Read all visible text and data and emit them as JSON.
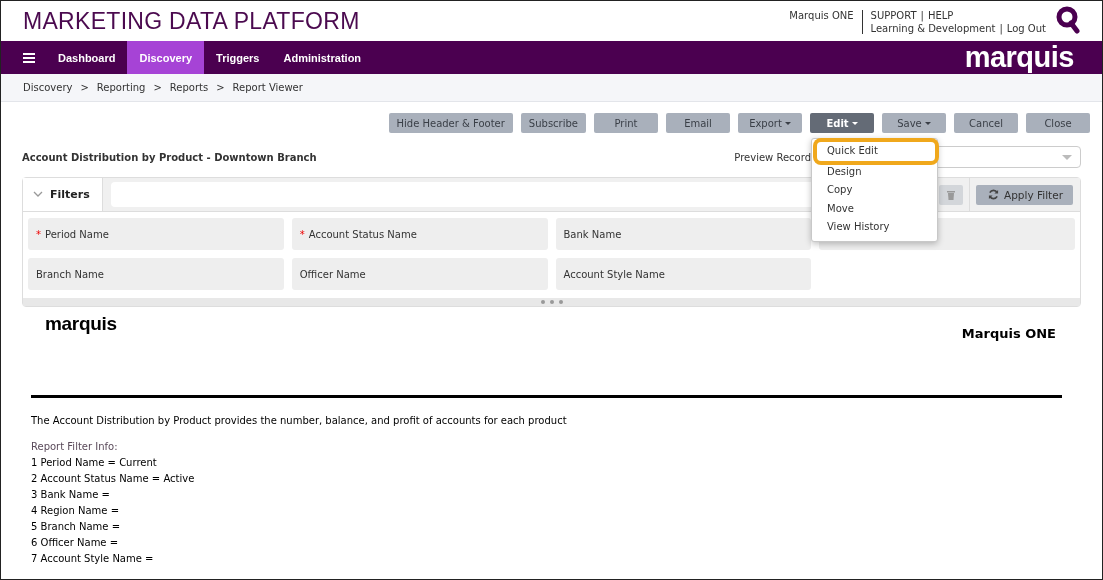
{
  "header": {
    "title": "MARKETING DATA PLATFORM",
    "user": "Marquis ONE",
    "separator": "|",
    "link_rows": [
      [
        "SUPPORT",
        "HELP"
      ],
      [
        "Learning & Development",
        "Log Out"
      ]
    ]
  },
  "nav": {
    "tabs": [
      {
        "label": "Dashboard",
        "selected": false
      },
      {
        "label": "Discovery",
        "selected": true
      },
      {
        "label": "Triggers",
        "selected": false
      },
      {
        "label": "Administration",
        "selected": false
      }
    ],
    "logo": "marquis"
  },
  "breadcrumb": {
    "separator": ">",
    "items": [
      "Discovery",
      "Reporting",
      "Reports",
      "Report Viewer"
    ]
  },
  "toolbar": [
    {
      "label": "Hide Header & Footer",
      "dropdown": false,
      "active": false
    },
    {
      "label": "Subscribe",
      "dropdown": false,
      "active": false
    },
    {
      "label": "Print",
      "dropdown": false,
      "active": false
    },
    {
      "label": "Email",
      "dropdown": false,
      "active": false
    },
    {
      "label": "Export",
      "dropdown": true,
      "active": false
    },
    {
      "label": "Edit",
      "dropdown": true,
      "active": true,
      "menu": [
        {
          "label": "Quick Edit",
          "highlighted": true
        },
        {
          "label": "Design",
          "highlighted": false
        },
        {
          "label": "Copy",
          "highlighted": false
        },
        {
          "label": "Move",
          "highlighted": false
        },
        {
          "label": "View History",
          "highlighted": false
        }
      ]
    },
    {
      "label": "Save",
      "dropdown": true,
      "active": false
    },
    {
      "label": "Cancel",
      "dropdown": false,
      "active": false
    },
    {
      "label": "Close",
      "dropdown": false,
      "active": false
    }
  ],
  "report_title": "Account Distribution by Product - Downtown Branch",
  "preview": {
    "label": "Preview Record"
  },
  "filters": {
    "label": "Filters",
    "expanded": true,
    "required_mark": "*",
    "apply_label": "Apply Filter",
    "fields": [
      {
        "kind": "field",
        "label": "Period Name",
        "required": true
      },
      {
        "kind": "field",
        "label": "Account Status Name",
        "required": true
      },
      {
        "kind": "field",
        "label": "Bank Name",
        "required": false
      },
      {
        "kind": "covered"
      },
      {
        "kind": "field",
        "label": "Branch Name",
        "required": false
      },
      {
        "kind": "field",
        "label": "Officer Name",
        "required": false
      },
      {
        "kind": "field",
        "label": "Account Style Name",
        "required": false
      }
    ]
  },
  "report": {
    "logo": "marquis",
    "company": "Marquis ONE",
    "description": "The Account Distribution by Product provides the number, balance, and profit of accounts for each product",
    "filter_info_title": "Report Filter Info:",
    "filter_info": [
      "1 Period Name = Current",
      "2 Account Status Name = Active",
      "3 Bank Name =",
      "4 Region Name =",
      "5 Branch Name =",
      "6 Officer Name =",
      "7 Account Style Name ="
    ]
  }
}
